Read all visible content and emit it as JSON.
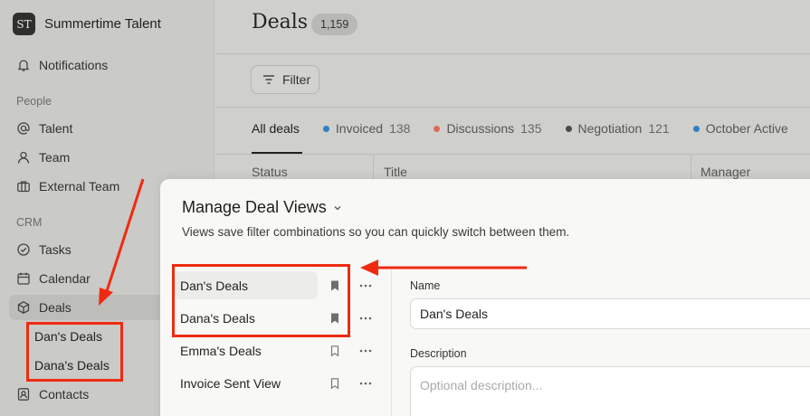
{
  "brand": {
    "logo_text": "ST",
    "name": "Summertime Talent"
  },
  "sidebar": {
    "notifications": "Notifications",
    "people_label": "People",
    "people": [
      "Talent",
      "Team",
      "External Team"
    ],
    "crm_label": "CRM",
    "crm": [
      "Tasks",
      "Calendar",
      "Deals"
    ],
    "deal_views": [
      "Dan's Deals",
      "Dana's Deals"
    ],
    "contacts": "Contacts"
  },
  "header": {
    "title": "Deals",
    "count": "1,159",
    "filter_label": "Filter"
  },
  "tabs": [
    {
      "label": "All deals",
      "count": "",
      "color": ""
    },
    {
      "label": "Invoiced",
      "count": "138",
      "color": "#2f7fc1"
    },
    {
      "label": "Discussions",
      "count": "135",
      "color": "#e0685a"
    },
    {
      "label": "Negotiation",
      "count": "121",
      "color": "#4a4a48"
    },
    {
      "label": "October Active",
      "count": "",
      "color": "#2f7fc1"
    }
  ],
  "columns": [
    "Status",
    "Title",
    "Manager"
  ],
  "modal": {
    "title": "Manage Deal Views",
    "description": "Views save filter combinations so you can quickly switch between them.",
    "views": [
      {
        "name": "Dan's Deals",
        "bookmarked": true
      },
      {
        "name": "Dana's Deals",
        "bookmarked": true
      },
      {
        "name": "Emma's Deals",
        "bookmarked": false
      },
      {
        "name": "Invoice Sent View",
        "bookmarked": false
      }
    ],
    "name_label": "Name",
    "name_value": "Dan's Deals",
    "description_label": "Description",
    "description_placeholder": "Optional description..."
  },
  "annotation_color": "#ee2b12"
}
